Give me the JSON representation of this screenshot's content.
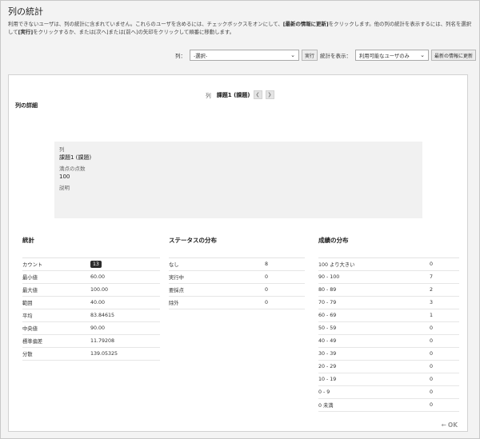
{
  "page": {
    "title": "列の統計",
    "instructions": [
      {
        "text": "利用できないユーザは、列の統計に含まれていません。これらのユーザを含めるには、チェックボックスをオンにして、",
        "bold": false
      },
      {
        "text": "[最新の情報に更新]",
        "bold": true
      },
      {
        "text": "をクリックします。他の列の統計を表示するには、列名を選択して",
        "bold": false
      },
      {
        "text": "[実行]",
        "bold": true
      },
      {
        "text": "をクリックするか、または[次へ]または[前へ]の矢印をクリックして順番に移動します。",
        "bold": false
      }
    ]
  },
  "toolbar": {
    "column_label": "列：",
    "column_select_value": "-選択-",
    "go_button": "実行",
    "show_stats_label": "統計を表示：",
    "users_select_value": "利用可能なユーザのみ",
    "refresh_button": "最新の情報に更新"
  },
  "nav": {
    "column_label": "列",
    "column_name": "課題1 (課題)",
    "prev_icon": "chevron-left-icon",
    "next_icon": "chevron-right-icon"
  },
  "details": {
    "heading": "列の詳細",
    "column_label": "列",
    "column_value": "課題1 (課題)",
    "points_label": "満点の点数",
    "points_value": "100",
    "description_label": "説明"
  },
  "stats": {
    "heading": "統計",
    "rows": [
      {
        "label": "カウント",
        "value": "13",
        "badge": true
      },
      {
        "label": "最小値",
        "value": "60.00"
      },
      {
        "label": "最大値",
        "value": "100.00"
      },
      {
        "label": "範囲",
        "value": "40.00"
      },
      {
        "label": "平均",
        "value": "83.84615"
      },
      {
        "label": "中央値",
        "value": "90.00"
      },
      {
        "label": "標準偏差",
        "value": "11.79208"
      },
      {
        "label": "分散",
        "value": "139.05325"
      }
    ]
  },
  "status": {
    "heading": "ステータスの分布",
    "rows": [
      {
        "label": "なし",
        "value": "8"
      },
      {
        "label": "実行中",
        "value": "0"
      },
      {
        "label": "要採点",
        "value": "0"
      },
      {
        "label": "除外",
        "value": "0"
      }
    ]
  },
  "grades": {
    "heading": "成績の分布",
    "rows": [
      {
        "label": "100 より大きい",
        "value": "0"
      },
      {
        "label": "90 - 100",
        "value": "7"
      },
      {
        "label": "80 - 89",
        "value": "2"
      },
      {
        "label": "70 - 79",
        "value": "3"
      },
      {
        "label": "60 - 69",
        "value": "1"
      },
      {
        "label": "50 - 59",
        "value": "0"
      },
      {
        "label": "40 - 49",
        "value": "0"
      },
      {
        "label": "30 - 39",
        "value": "0"
      },
      {
        "label": "20 - 29",
        "value": "0"
      },
      {
        "label": "10 - 19",
        "value": "0"
      },
      {
        "label": "0 - 9",
        "value": "0"
      },
      {
        "label": "0 未満",
        "value": "0"
      }
    ]
  },
  "footer": {
    "ok_label": "OK",
    "ok_icon": "arrow-left-icon"
  }
}
